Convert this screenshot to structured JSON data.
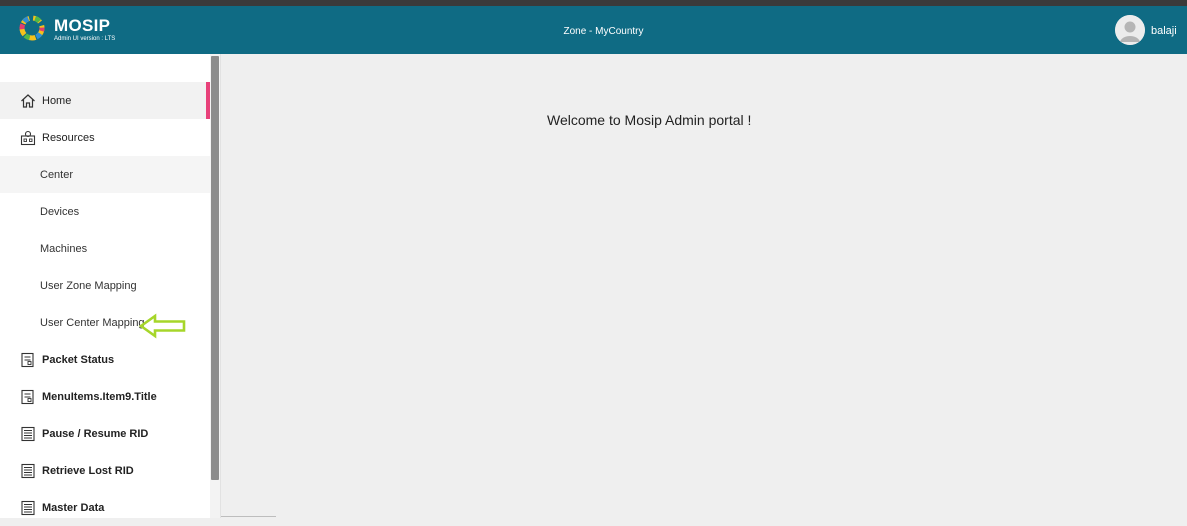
{
  "header": {
    "brand": "MOSIP",
    "version": "Admin UI version : LTS",
    "zone": "Zone - MyCountry",
    "username": "balaji",
    "background_color": "#0f6b84"
  },
  "sidebar": {
    "items": [
      {
        "label": "Home",
        "icon": "home-icon"
      },
      {
        "label": "Resources",
        "icon": "resources-icon"
      },
      {
        "label": "Center"
      },
      {
        "label": "Devices"
      },
      {
        "label": "Machines"
      },
      {
        "label": "User Zone Mapping"
      },
      {
        "label": "User Center Mapping"
      },
      {
        "label": "Packet Status",
        "icon": "packet-status-icon"
      },
      {
        "label": "MenuItems.Item9.Title",
        "icon": "document-icon"
      },
      {
        "label": "Pause / Resume RID",
        "icon": "list-icon"
      },
      {
        "label": "Retrieve Lost RID",
        "icon": "list-icon"
      },
      {
        "label": "Master Data",
        "icon": "list-icon"
      }
    ],
    "active_indicator_color": "#e8417a"
  },
  "main": {
    "welcome": "Welcome to Mosip Admin portal !"
  },
  "annotation": {
    "arrow_color": "#a6d62a",
    "points_to": "User Center Mapping"
  }
}
